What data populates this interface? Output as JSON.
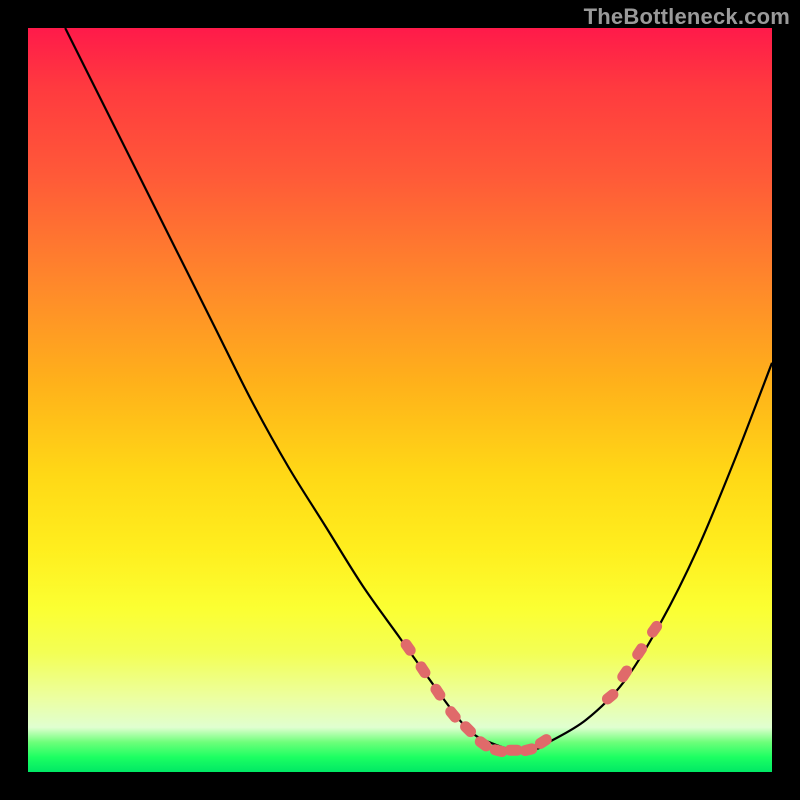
{
  "watermark": "TheBottleneck.com",
  "chart_data": {
    "type": "line",
    "title": "",
    "xlabel": "",
    "ylabel": "",
    "xlim": [
      0,
      100
    ],
    "ylim": [
      0,
      100
    ],
    "grid": false,
    "legend": false,
    "annotations": [],
    "series": [
      {
        "name": "bottleneck-curve",
        "color": "#000000",
        "x": [
          5,
          10,
          15,
          20,
          25,
          30,
          35,
          40,
          45,
          50,
          55,
          58,
          60,
          62,
          65,
          68,
          70,
          75,
          80,
          85,
          90,
          95,
          100
        ],
        "values": [
          100,
          90,
          80,
          70,
          60,
          50,
          41,
          33,
          25,
          18,
          11,
          7,
          5,
          4,
          3,
          3,
          4,
          7,
          12,
          20,
          30,
          42,
          55
        ]
      },
      {
        "name": "highlight-markers",
        "color": "#e06a6a",
        "style": "dash-markers",
        "x": [
          51,
          53,
          55,
          57,
          59,
          61,
          63,
          65,
          67,
          69,
          78,
          80,
          82,
          84
        ],
        "values": [
          17,
          14,
          11,
          8,
          6,
          4,
          3,
          3,
          3,
          4,
          10,
          13,
          16,
          19
        ]
      }
    ]
  }
}
